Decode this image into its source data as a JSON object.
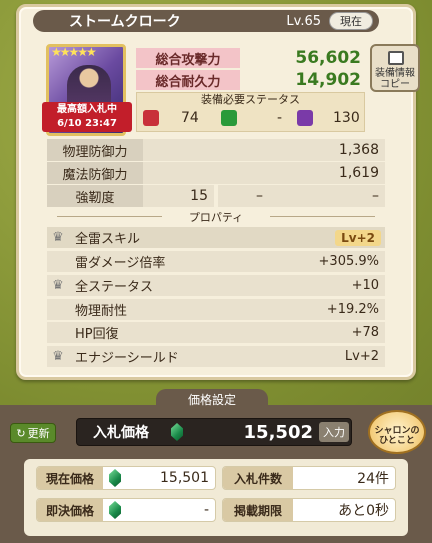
{
  "item": {
    "name": "ストームクローク",
    "level": "Lv.65",
    "current_label": "現在"
  },
  "auction_tag": {
    "line1": "最高額入札中",
    "line2": "6/10 23:47"
  },
  "stats": {
    "attack_label": "総合攻撃力",
    "attack_value": "56,602",
    "durability_label": "総合耐久力",
    "durability_value": "14,902"
  },
  "requirements": {
    "header": "装備必要ステータス",
    "items": [
      {
        "icon": "red-stat-icon",
        "value": "74"
      },
      {
        "icon": "green-stat-icon",
        "value": "-"
      },
      {
        "icon": "purple-stat-icon",
        "value": "130"
      }
    ]
  },
  "copy_button": {
    "line1": "装備情報",
    "line2": "コピー"
  },
  "defense": [
    {
      "label": "物理防御力",
      "value": "1,368"
    },
    {
      "label": "魔法防御力",
      "value": "1,619"
    }
  ],
  "toughness": {
    "label": "強靭度",
    "value": "15",
    "slot2": "–",
    "slot3": "–"
  },
  "properties": {
    "header": "プロパティ",
    "rows": [
      {
        "crown": true,
        "name": "全雷スキル",
        "value": "Lv+2",
        "badge": true
      },
      {
        "crown": false,
        "name": "雷ダメージ倍率",
        "value": "+305.9%"
      },
      {
        "crown": true,
        "name": "全ステータス",
        "value": "+10"
      },
      {
        "crown": false,
        "name": "物理耐性",
        "value": "+19.2%"
      },
      {
        "crown": false,
        "name": "HP回復",
        "value": "+78"
      },
      {
        "crown": true,
        "name": "エナジーシールド",
        "value": "Lv+2"
      }
    ]
  },
  "price_section": {
    "tab_label": "価格設定",
    "refresh_label": "更新",
    "bid_label": "入札価格",
    "bid_amount": "15,502",
    "input_label": "入力",
    "sharon_line1": "シャロンの",
    "sharon_line2": "ひとこと"
  },
  "info": {
    "current_price_label": "現在価格",
    "current_price_value": "15,501",
    "bid_count_label": "入札件数",
    "bid_count_value": "24件",
    "buyout_label": "即決価格",
    "buyout_value": "-",
    "deadline_label": "掲載期限",
    "deadline_value": "あと0秒"
  }
}
